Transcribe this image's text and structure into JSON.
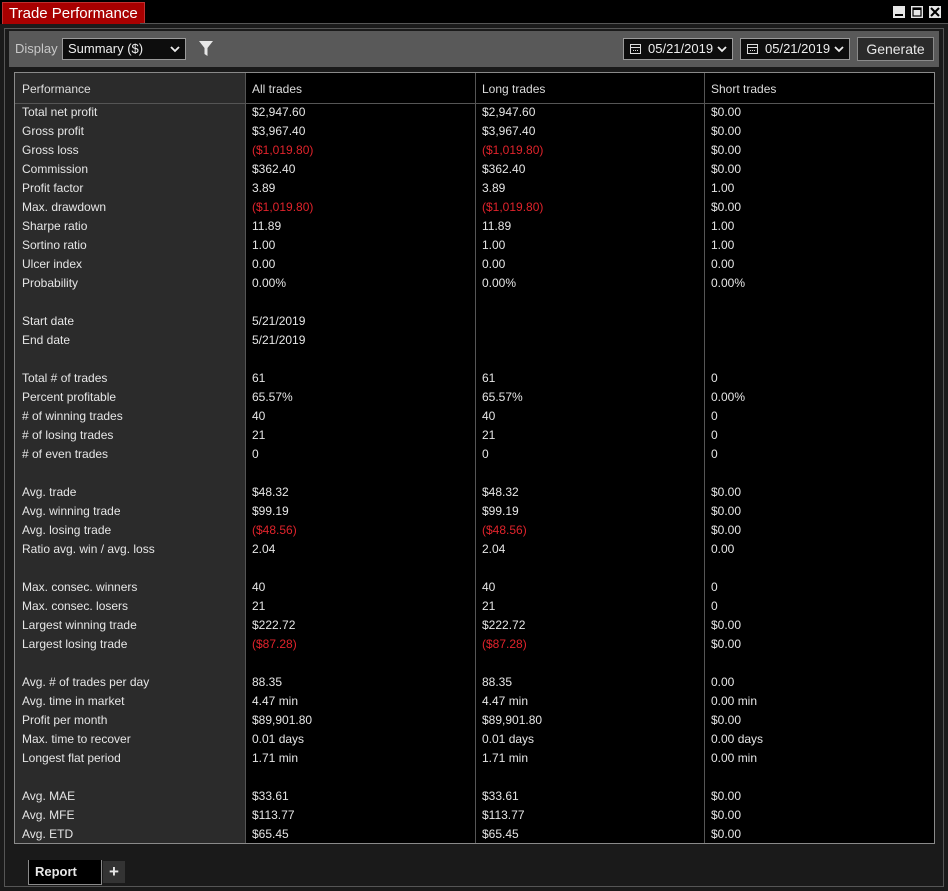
{
  "window": {
    "title": "Trade Performance"
  },
  "toolbar": {
    "display_label": "Display",
    "display_value": "Summary ($)",
    "from_date": "05/21/2019",
    "to_date": "05/21/2019",
    "generate_label": "Generate"
  },
  "table": {
    "headers": [
      "Performance",
      "All trades",
      "Long trades",
      "Short trades"
    ],
    "rows": [
      [
        "Total net profit",
        "$2,947.60",
        "$2,947.60",
        "$0.00"
      ],
      [
        "Gross profit",
        "$3,967.40",
        "$3,967.40",
        "$0.00"
      ],
      [
        "Gross loss",
        "($1,019.80)",
        "($1,019.80)",
        "$0.00"
      ],
      [
        "Commission",
        "$362.40",
        "$362.40",
        "$0.00"
      ],
      [
        "Profit factor",
        "3.89",
        "3.89",
        "1.00"
      ],
      [
        "Max. drawdown",
        "($1,019.80)",
        "($1,019.80)",
        "$0.00"
      ],
      [
        "Sharpe ratio",
        "11.89",
        "11.89",
        "1.00"
      ],
      [
        "Sortino ratio",
        "1.00",
        "1.00",
        "1.00"
      ],
      [
        "Ulcer index",
        "0.00",
        "0.00",
        "0.00"
      ],
      [
        "Probability",
        "0.00%",
        "0.00%",
        "0.00%"
      ],
      [
        "",
        "",
        "",
        ""
      ],
      [
        "Start date",
        "5/21/2019",
        "",
        ""
      ],
      [
        "End date",
        "5/21/2019",
        "",
        ""
      ],
      [
        "",
        "",
        "",
        ""
      ],
      [
        "Total # of trades",
        "61",
        "61",
        "0"
      ],
      [
        "Percent profitable",
        "65.57%",
        "65.57%",
        "0.00%"
      ],
      [
        "# of winning trades",
        "40",
        "40",
        "0"
      ],
      [
        "# of losing trades",
        "21",
        "21",
        "0"
      ],
      [
        "# of even trades",
        "0",
        "0",
        "0"
      ],
      [
        "",
        "",
        "",
        ""
      ],
      [
        "Avg. trade",
        "$48.32",
        "$48.32",
        "$0.00"
      ],
      [
        "Avg. winning trade",
        "$99.19",
        "$99.19",
        "$0.00"
      ],
      [
        "Avg. losing trade",
        "($48.56)",
        "($48.56)",
        "$0.00"
      ],
      [
        "Ratio avg. win / avg. loss",
        "2.04",
        "2.04",
        "0.00"
      ],
      [
        "",
        "",
        "",
        ""
      ],
      [
        "Max. consec. winners",
        "40",
        "40",
        "0"
      ],
      [
        "Max. consec. losers",
        "21",
        "21",
        "0"
      ],
      [
        "Largest winning trade",
        "$222.72",
        "$222.72",
        "$0.00"
      ],
      [
        "Largest losing trade",
        "($87.28)",
        "($87.28)",
        "$0.00"
      ],
      [
        "",
        "",
        "",
        ""
      ],
      [
        "Avg. # of trades per day",
        "88.35",
        "88.35",
        "0.00"
      ],
      [
        "Avg. time in market",
        "4.47 min",
        "4.47 min",
        "0.00 min"
      ],
      [
        "Profit per month",
        "$89,901.80",
        "$89,901.80",
        "$0.00"
      ],
      [
        "Max. time to recover",
        "0.01 days",
        "0.01 days",
        "0.00 days"
      ],
      [
        "Longest flat period",
        "1.71 min",
        "1.71 min",
        "0.00 min"
      ],
      [
        "",
        "",
        "",
        ""
      ],
      [
        "Avg. MAE",
        "$33.61",
        "$33.61",
        "$0.00"
      ],
      [
        "Avg. MFE",
        "$113.77",
        "$113.77",
        "$0.00"
      ],
      [
        "Avg. ETD",
        "$65.45",
        "$65.45",
        "$0.00"
      ]
    ]
  },
  "tabs": {
    "report_label": "Report",
    "add_label": "+"
  },
  "colors": {
    "title_bg": "#a80000",
    "negative": "#e0232b",
    "toolbar_bg": "#595959",
    "label_column_bg": "#2b2b2b"
  }
}
